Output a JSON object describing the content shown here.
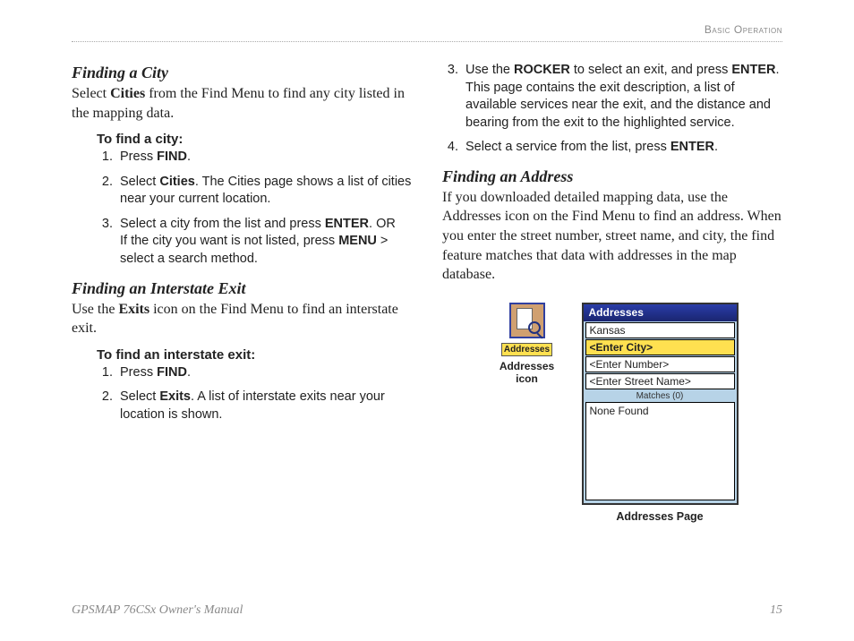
{
  "header": {
    "section": "Basic Operation"
  },
  "footer": {
    "left": "GPSMAP 76CSx Owner's Manual",
    "page": "15"
  },
  "left": {
    "sec1": {
      "title": "Finding a City",
      "intro_pre": "Select ",
      "intro_b": "Cities",
      "intro_post": " from the Find Menu to find any city listed in the mapping data.",
      "howto": "To find a city:",
      "s1_pre": "Press ",
      "s1_b": "FIND",
      "s1_post": ".",
      "s2_pre": "Select ",
      "s2_b": "Cities",
      "s2_post": ". The Cities page shows a list of cities near your current location.",
      "s3_pre": "Select a city from the list and press ",
      "s3_b": "ENTER",
      "s3_mid": ". OR",
      "s3_line2_pre": "If the city you want is not listed, press ",
      "s3_b2": "MENU",
      "s3_line2_post": " > select a search method."
    },
    "sec2": {
      "title": "Finding an Interstate Exit",
      "intro_pre": "Use the ",
      "intro_b": "Exits",
      "intro_post": " icon on the Find Menu to find an interstate exit.",
      "howto": "To find an interstate exit:",
      "s1_pre": "Press ",
      "s1_b": "FIND",
      "s1_post": ".",
      "s2_pre": "Select ",
      "s2_b": "Exits",
      "s2_post": ". A list of interstate exits near your location is shown."
    }
  },
  "right": {
    "cont": {
      "s3_a": "Use the ",
      "s3_b1": "ROCKER",
      "s3_c": " to select an exit, and press ",
      "s3_b2": "ENTER",
      "s3_d": ". This page contains the exit description, a list of available services near the exit, and the distance and bearing from the exit to the highlighted service.",
      "s4_a": "Select a service from the list, press ",
      "s4_b": "ENTER",
      "s4_c": "."
    },
    "sec3": {
      "title": "Finding an Address",
      "intro": "If you downloaded detailed mapping data, use the Addresses icon on the Find Menu to find an address. When you enter the street number, street name, and city, the find feature matches that data with addresses in the map database."
    },
    "figure": {
      "icon_label": "Addresses",
      "icon_caption_l1": "Addresses",
      "icon_caption_l2": "icon",
      "panel_title": "Addresses",
      "rows": {
        "r0": "Kansas",
        "r1": "<Enter City>",
        "r2": "<Enter Number>",
        "r3": "<Enter Street Name>"
      },
      "matches": "Matches (0)",
      "list_item": "None Found",
      "caption": "Addresses Page"
    }
  }
}
